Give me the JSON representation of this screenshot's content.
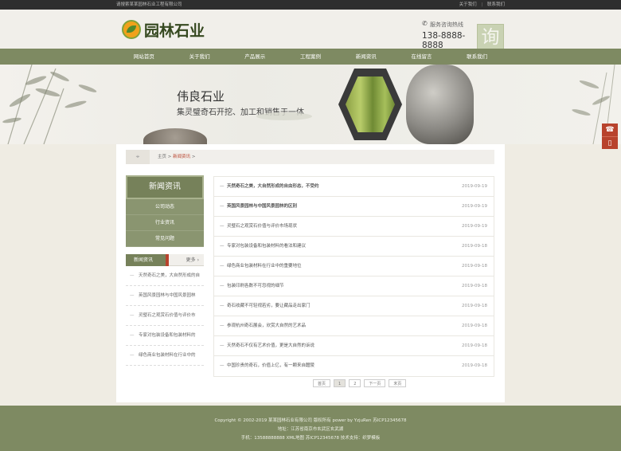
{
  "topbar": {
    "welcome": "请搜索某某园林石业工程有限公司",
    "about": "关于我们",
    "sep": "|",
    "contact": "联系我们"
  },
  "header": {
    "logo_text": "园林石业",
    "hotline_label": "服务咨询热线",
    "hotline_number": "138-8888-8888",
    "seal_char": "询"
  },
  "nav": {
    "items": [
      "网站首页",
      "关于我们",
      "产品展示",
      "工程案例",
      "新闻资讯",
      "在线留言",
      "联系我们"
    ]
  },
  "banner": {
    "title": "伟良石业",
    "subtitle": "集灵璧奇石开挖、加工和销售于一体"
  },
  "float": {
    "service_icon": "headset-icon",
    "phone_icon": "mobile-icon"
  },
  "breadcrumb": {
    "home": "主页",
    "sep": " > ",
    "current": "新闻资讯",
    "tail": " >"
  },
  "sidebar": {
    "title": "新闻资讯",
    "menu": [
      "公司动态",
      "行业资讯",
      "常见问题"
    ],
    "news_head": "新闻资讯",
    "more": "更多",
    "news": [
      "天然奇石之美，大自然形成的自",
      "英国风景园林与中国风景园林",
      "灵璧石之观赏石价值与评价市",
      "专家对包装设备和包装材料的",
      "绿色商业包装材料在行业中的"
    ]
  },
  "list": [
    {
      "title": "天然奇石之美，大自然形成的自由形态，不受约",
      "date": "2019-09-19",
      "bold": true
    },
    {
      "title": "英国风景园林与中国风景园林的区别",
      "date": "2019-09-19",
      "bold": true
    },
    {
      "title": "灵璧石之观赏石价值与评价市场现状",
      "date": "2019-09-19",
      "bold": false
    },
    {
      "title": "专家对包装设备和包装材料的看法和建议",
      "date": "2019-09-18",
      "bold": false
    },
    {
      "title": "绿色商业包装材料在行业中的重要地位",
      "date": "2019-09-18",
      "bold": false
    },
    {
      "title": "包装印刷各数不可忽视的细节",
      "date": "2019-09-18",
      "bold": false
    },
    {
      "title": "奇石收藏不可轻视若劣，要让藏品走出家门",
      "date": "2019-09-18",
      "bold": false
    },
    {
      "title": "参观杭州奇石展会，欣赏大自然的艺术品",
      "date": "2019-09-18",
      "bold": false
    },
    {
      "title": "天然奇石不仅有艺术价值，更是大自然的诉说",
      "date": "2019-09-18",
      "bold": false
    },
    {
      "title": "中国珍贵的奇石，价值上亿，有一颗来自醴陵",
      "date": "2019-09-18",
      "bold": false
    }
  ],
  "pager": {
    "first": "首页",
    "p1": "1",
    "p2": "2",
    "next": "下一页",
    "last": "末页"
  },
  "footer": {
    "line1": "Copyright © 2002-2019 某某园林石业有限公司 版权所有 power by YzjuRen   苏ICP12345678",
    "line2": "地址：江苏省南京市玄武区玄武湖",
    "line3": "手机：13588888888   XML地图   苏ICP12345678 技术支持：织梦模板"
  }
}
